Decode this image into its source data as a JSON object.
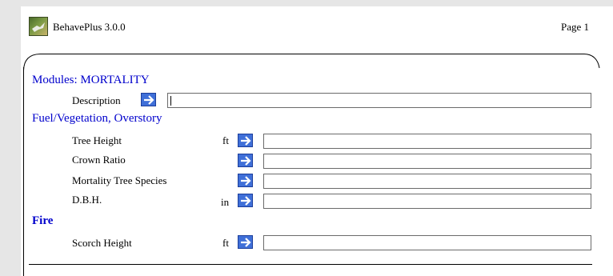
{
  "header": {
    "app_title": "BehavePlus 3.0.0",
    "page_label": "Page 1"
  },
  "sections": {
    "modules": "Modules: MORTALITY",
    "fuel": "Fuel/Vegetation, Overstory",
    "fire": "Fire"
  },
  "rows": {
    "description": {
      "label": "Description",
      "units": "",
      "value": ""
    },
    "tree_height": {
      "label": "Tree Height",
      "units": "ft",
      "value": ""
    },
    "crown_ratio": {
      "label": "Crown Ratio",
      "units": "",
      "value": ""
    },
    "species": {
      "label": "Mortality Tree Species",
      "units": "",
      "value": ""
    },
    "dbh": {
      "label": "D.B.H.",
      "units": "in",
      "value": ""
    },
    "scorch_height": {
      "label": "Scorch Height",
      "units": "ft",
      "value": ""
    }
  },
  "icons": {
    "app": "behaveplus-logo-icon",
    "input_button": "arrow-right-icon"
  },
  "colors": {
    "section_text": "#0000cc",
    "arrow_button": "#3f6fd8",
    "background": "#e6e6e6"
  }
}
